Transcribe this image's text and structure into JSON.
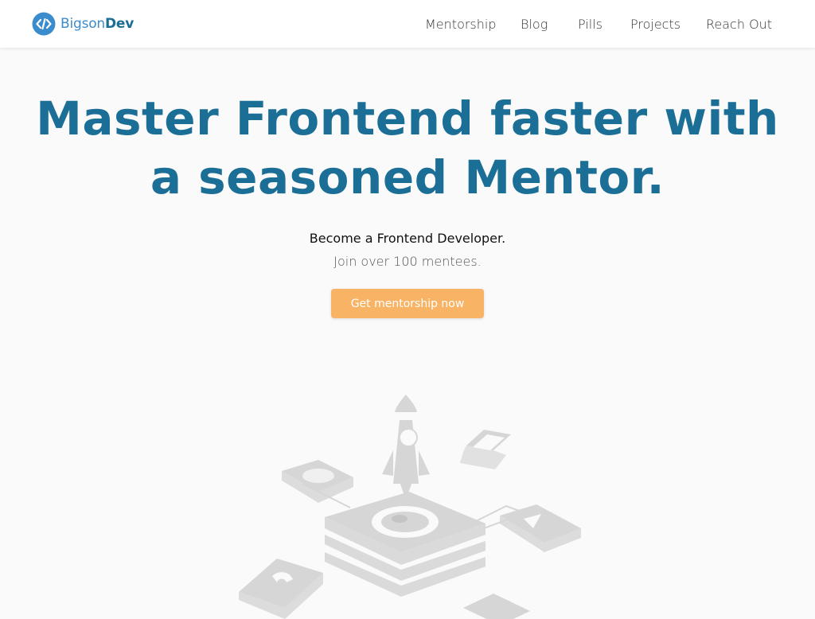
{
  "brand": {
    "name_part1": "Bigson",
    "name_part2": "Dev"
  },
  "nav": {
    "items": [
      {
        "label": "Mentorship"
      },
      {
        "label": "Blog"
      },
      {
        "label": "Pills"
      },
      {
        "label": "Projects"
      },
      {
        "label": "Reach Out"
      }
    ]
  },
  "hero": {
    "title_line1": "Master Frontend faster with",
    "title_line2": "a seasoned Mentor.",
    "subtitle": "Become a Frontend Developer.",
    "subtext": "Join over 100 mentees.",
    "cta_label": "Get mentorship now"
  },
  "colors": {
    "brand_primary": "#1b6e96",
    "brand_light": "#3b8ccc",
    "cta": "#f8b464",
    "illustration_gray": "#d6d6d6",
    "background": "#fafafa"
  },
  "illustration": {
    "icon": "rocket-launch-isometric-icon"
  }
}
